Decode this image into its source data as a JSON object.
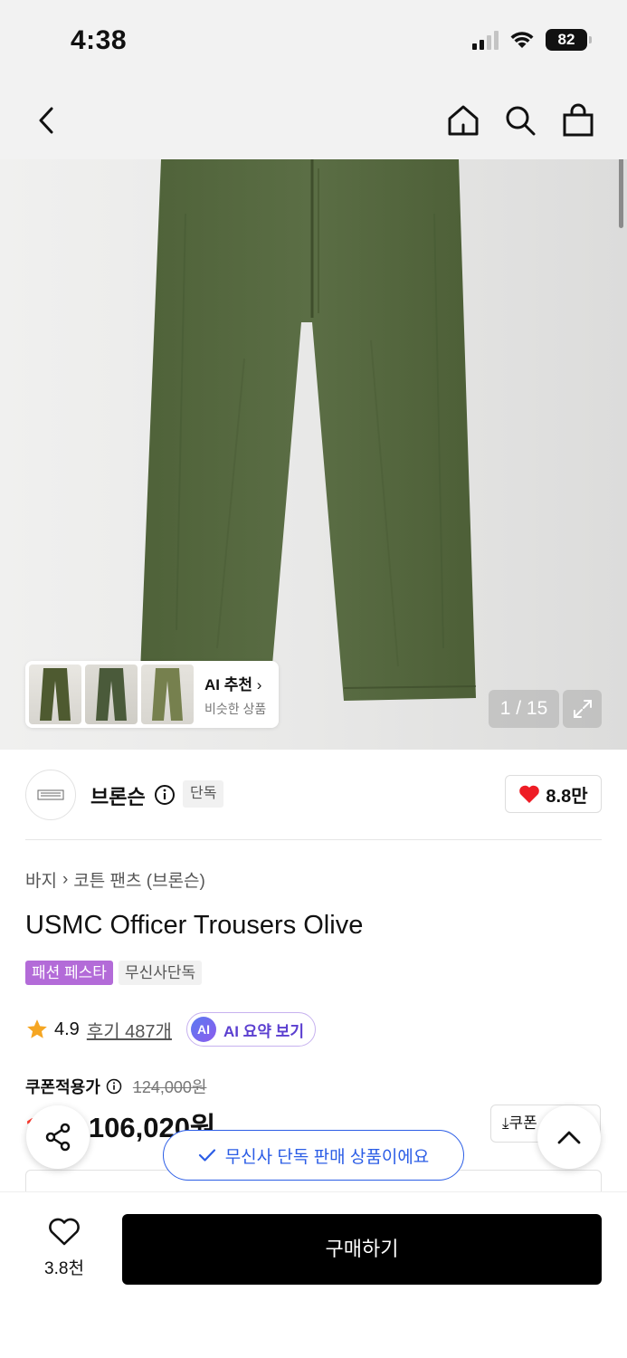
{
  "status_bar": {
    "time": "4:38",
    "battery": "82"
  },
  "nav": {
    "back_icon": "chevron-left-icon",
    "home_icon": "home-icon",
    "search_icon": "search-icon",
    "cart_icon": "shopping-bag-icon"
  },
  "gallery": {
    "ai_recommend_title": "AI 추천",
    "ai_recommend_sub": "비슷한 상품",
    "counter": "1 / 15",
    "expand_icon": "expand-icon"
  },
  "brand": {
    "name": "브론슨",
    "badge": "단독",
    "likes": "8.8만"
  },
  "breadcrumb": {
    "category": "바지",
    "subcategory": "코튼 팬츠 (브론슨)"
  },
  "product": {
    "title": "USMC Officer Trousers Olive",
    "tags": [
      "패션 페스타",
      "무신사단독"
    ],
    "rating": "4.9",
    "reviews": "후기 487개",
    "ai_summary": "AI 요약 보기",
    "ai_badge": "AI"
  },
  "price": {
    "coupon_label": "쿠폰적용가",
    "original_price": "124,000원",
    "discount": "1",
    "final_price": "106,020원",
    "coupon_button": "쿠폰"
  },
  "toast": {
    "message": "무신사 단독 판매 상품이에요"
  },
  "bottom": {
    "wish_count": "3.8천",
    "buy_label": "구매하기"
  },
  "colors": {
    "accent_blue": "#2b5de6",
    "purple_tag": "#b36bd8",
    "discount_red": "#ff3b30",
    "olive": "#55673f"
  }
}
